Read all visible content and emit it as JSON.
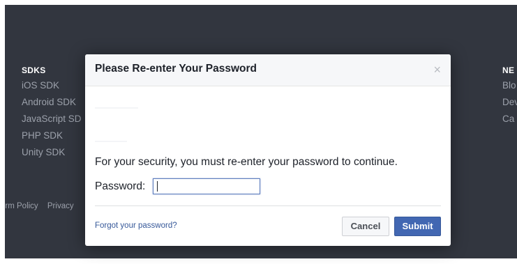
{
  "background": {
    "sdks_column": {
      "heading": "SDKS",
      "items": [
        "iOS SDK",
        "Android SDK",
        "JavaScript SD",
        "PHP SDK",
        "Unity SDK"
      ]
    },
    "right_column": {
      "heading": "NE",
      "items": [
        "Blo",
        "Dev",
        "Ca"
      ]
    },
    "policy_links": [
      "orm Policy",
      "Privacy"
    ]
  },
  "dialog": {
    "title": "Please Re-enter Your Password",
    "close_symbol": "×",
    "message": "For your security, you must re-enter your password to continue.",
    "password_label": "Password:",
    "password_value": "",
    "forgot_link": "Forgot your password?",
    "cancel_label": "Cancel",
    "submit_label": "Submit"
  },
  "colors": {
    "backdrop": "#32363f",
    "header_bg": "#f6f7f9",
    "submit_bg": "#4267b2",
    "link": "#365899"
  }
}
